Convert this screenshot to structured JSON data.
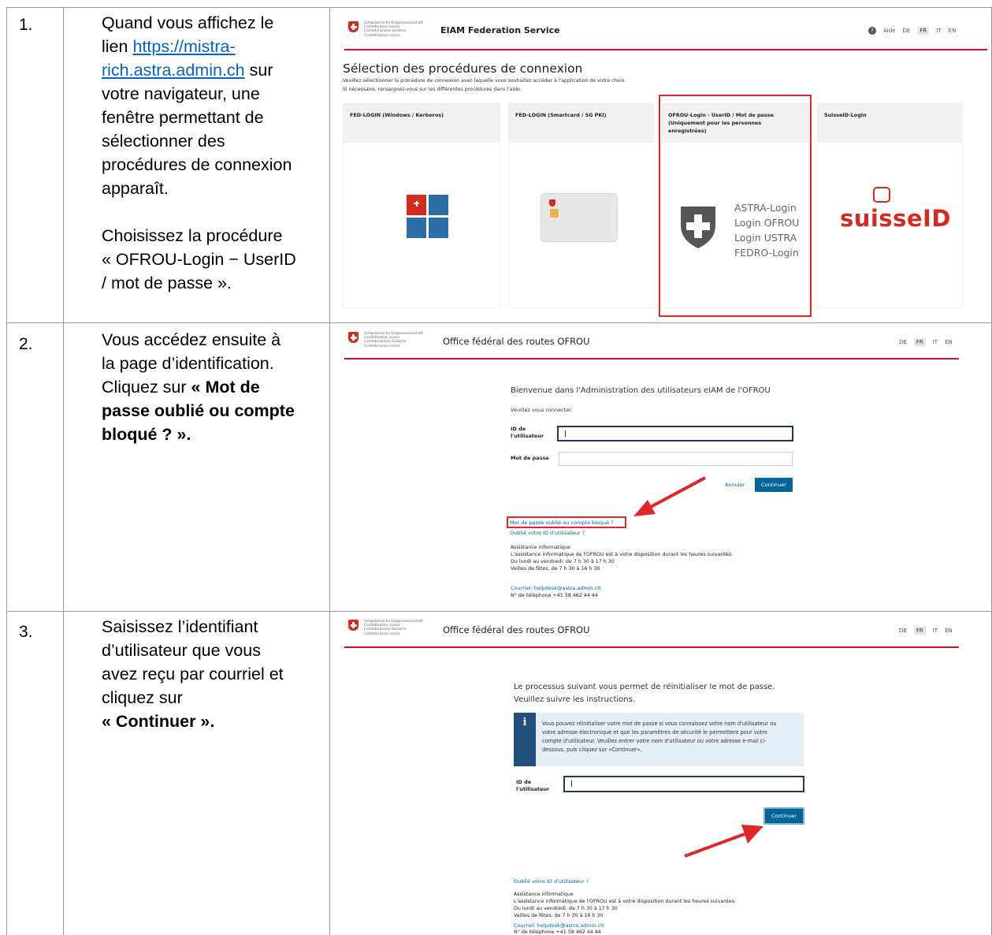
{
  "steps": [
    {
      "number": "1.",
      "text_lines": [
        "Quand vous affichez le"
      ],
      "link_prefix": "lien ",
      "link_line1": "https://mistra-",
      "link_line2": "rich.astra.admin.ch",
      "link_suffix": " sur",
      "text_after": [
        "votre navigateur, une",
        "fenêtre permettant de",
        "sélectionner des",
        "procédures de connexion",
        "apparaît."
      ],
      "text_choose": [
        "Choisissez la procédure",
        "« OFROU-Login − UserID",
        "/ mot de passe »."
      ]
    },
    {
      "number": "2.",
      "lines": [
        "Vous accédez ensuite à",
        "la page d’identification.",
        "Cliquez sur "
      ],
      "bold_1": "« Mot de",
      "bold_2": "passe oublié ou compte",
      "bold_3": "bloqué ? »."
    },
    {
      "number": "3.",
      "lines": [
        "Saisissez l’identifiant",
        "d’utilisateur que vous",
        "avez reçu par courriel et",
        "cliquez sur"
      ],
      "bold": "« Continuer »."
    }
  ],
  "federal_lines": [
    "Schweizerische Eidgenossenschaft",
    "Confédération suisse",
    "Confederazione Svizzera",
    "Confederaziun svizra"
  ],
  "shot1": {
    "app_title": "EIAM Federation Service",
    "help": "Aide",
    "langs": [
      "DE",
      "FR",
      "IT",
      "EN"
    ],
    "active_lang": "FR",
    "title": "Sélection des procédures de connexion",
    "sub1": "Veuillez sélectionner la procédure de connexion avec laquelle vous souhaitez accéder à l'application de votre choix.",
    "sub2": "Si nécessaire, renseignez-vous sur les différentes procédures dans l'aide.",
    "cards": [
      {
        "title": "FED-LOGIN (Windows / Kerberos)"
      },
      {
        "title": "FED-LOGIN (Smartcard / SG PKI)"
      },
      {
        "title": "OFROU-Login - UserID / Mot de passe",
        "title2": "(Uniquement pour les personnes",
        "title3": "enregistrées)"
      },
      {
        "title": "SuisseID-Login"
      }
    ],
    "astra_lines": [
      "ASTRA-Login",
      "Login OFROU",
      "Login USTRA",
      "FEDRO-Login"
    ],
    "suisseid": "suisseID"
  },
  "shot2": {
    "office": "Office fédéral des routes OFROU",
    "langs": [
      "DE",
      "FR",
      "IT",
      "EN"
    ],
    "active_lang": "FR",
    "welcome": "Bienvenue dans l'Administration des utilisateurs eIAM de l'OFROU",
    "connect": "Veuillez vous connecter.",
    "userid_label_1": "ID de",
    "userid_label_2": "l'utilisateur",
    "password_label": "Mot de passe",
    "cancel": "Annuler",
    "continue": "Continuer",
    "forgot_password": "Mot de passe oublié ou compte bloqué ?",
    "forgot_userid": "Oublié votre ID d'utilisateur ?",
    "support_lines": [
      "Assistance informatique",
      "L'assistance informatique de l'OFROU est à votre disposition durant les heures suivantes:",
      "Du lundi au vendredi: de 7 h 30 à 17 h 30",
      "Veilles de fêtes, de 7 h 30 à 16 h 30"
    ],
    "email": "Courriel: helpdesk@astra.admin.ch",
    "phone": "N° de téléphone +41 58 462 44 44"
  },
  "shot3": {
    "office": "Office fédéral des routes OFROU",
    "langs": [
      "DE",
      "FR",
      "IT",
      "EN"
    ],
    "active_lang": "FR",
    "intro1": "Le processus suivant vous permet de réinitialiser le mot de passe.",
    "intro2": "Veuillez suivre les instructions.",
    "info_lines": [
      "Vous pouvez réinitialiser votre mot de passe si vous connaissez votre nom d'utilisateur ou",
      "votre adresse électronique et que les paramètres de sécurité le permettent pour votre",
      "compte d'utilisateur. Veuillez entrer votre nom d'utilisateur ou votre adresse e-mail ci-",
      "dessous, puis cliquez sur «Continuer»."
    ],
    "info_icon": "i",
    "userid_label_1": "ID de",
    "userid_label_2": "l'utilisateur",
    "continue": "Continuer",
    "forgot_userid": "Oublié votre ID d'utilisateur ?",
    "support_lines": [
      "Assistance informatique",
      "L'assistance informatique de l'OFROU est à votre disposition durant les heures suivantes:",
      "Du lundi au vendredi: de 7 h 30 à 17 h 30",
      "Veilles de fêtes, de 7 h 30 à 16 h 30"
    ],
    "email": "Courriel: helpdesk@astra.admin.ch",
    "phone": "N° de téléphone +41 58 462 44 44"
  }
}
